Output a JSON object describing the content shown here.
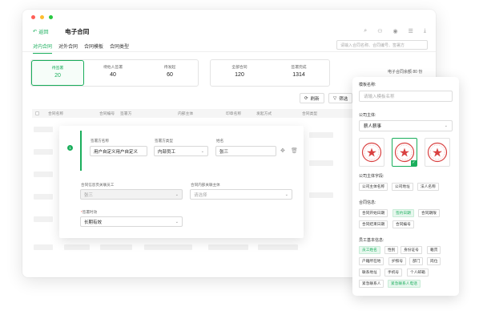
{
  "window": {
    "back_label": "返回",
    "title": "电子合同",
    "colors": {
      "accent": "#1aae5c",
      "dot_red": "#ff5f57",
      "dot_yellow": "#febc2e",
      "dot_green": "#28c840"
    },
    "toolbar_icons": [
      "search-icon",
      "org-icon",
      "eye-icon",
      "list-icon",
      "download-icon"
    ]
  },
  "tabs": [
    {
      "label": "对内合同",
      "active": true
    },
    {
      "label": "对外合同",
      "active": false
    },
    {
      "label": "合同模板",
      "active": false
    },
    {
      "label": "合同类型",
      "active": false
    }
  ],
  "search": {
    "placeholder": "请输入合同名称、合同编号、签署方"
  },
  "stats": {
    "group1": [
      {
        "label": "待签署",
        "value": "20",
        "active": true
      },
      {
        "label": "待他人签署",
        "value": "40"
      },
      {
        "label": "待发起",
        "value": "60"
      }
    ],
    "group2": [
      {
        "label": "全部合同",
        "value": "120"
      },
      {
        "label": "签署完成",
        "value": "1314"
      }
    ],
    "remaining": "电子合同余额 80 份"
  },
  "actions": {
    "refresh": "刷新",
    "filter": "筛选"
  },
  "table": {
    "headers": [
      "合同名称",
      "合同编号",
      "签署方",
      "内部主体",
      "印章名称",
      "发起方式",
      "合同类型"
    ]
  },
  "form": {
    "step": "1",
    "signer_name_label": "签署方名称",
    "signer_name_value": "用户自定义用户自定义",
    "signer_type_label": "签署方类型",
    "signer_type_value": "内部员工",
    "name_label": "姓名",
    "name_value": "张三",
    "related_employee_label": "合同信息页关联员工",
    "related_employee_value": "张三",
    "internal_subject_label": "合同内部关联主体",
    "internal_subject_placeholder": "请选择",
    "validity_label": "签署时效",
    "validity_value": "长期有效"
  },
  "panel": {
    "template_name_label": "模板名称:",
    "template_name_placeholder": "请输入模板名称",
    "company_label": "公司主体:",
    "company_value": "薪人薪事",
    "seal_text": "薪人薪事",
    "company_fields_label": "公司主体字段:",
    "company_fields": [
      "公司主体名称",
      "公司地址",
      "法人名称"
    ],
    "contract_info_label": "合同信息:",
    "contract_info": [
      {
        "label": "合同开始日期",
        "on": false
      },
      {
        "label": "签约日期",
        "on": true
      },
      {
        "label": "合同期限",
        "on": false
      },
      {
        "label": "合同结束日期",
        "on": false
      },
      {
        "label": "合同编号",
        "on": false
      }
    ],
    "employee_info_label": "员工基本信息:",
    "employee_info": [
      {
        "label": "员工姓名",
        "on": true
      },
      {
        "label": "性别",
        "on": false
      },
      {
        "label": "身份证号",
        "on": false
      },
      {
        "label": "籍贯",
        "on": false
      },
      {
        "label": "户籍所在地",
        "on": false
      },
      {
        "label": "护照号",
        "on": false
      },
      {
        "label": "部门",
        "on": false
      },
      {
        "label": "岗位",
        "on": false
      },
      {
        "label": "联系地址",
        "on": false
      },
      {
        "label": "手机号",
        "on": false
      },
      {
        "label": "个人邮箱",
        "on": false
      },
      {
        "label": "紧急联系人",
        "on": false
      },
      {
        "label": "紧急联系人电话",
        "on": true
      }
    ]
  }
}
